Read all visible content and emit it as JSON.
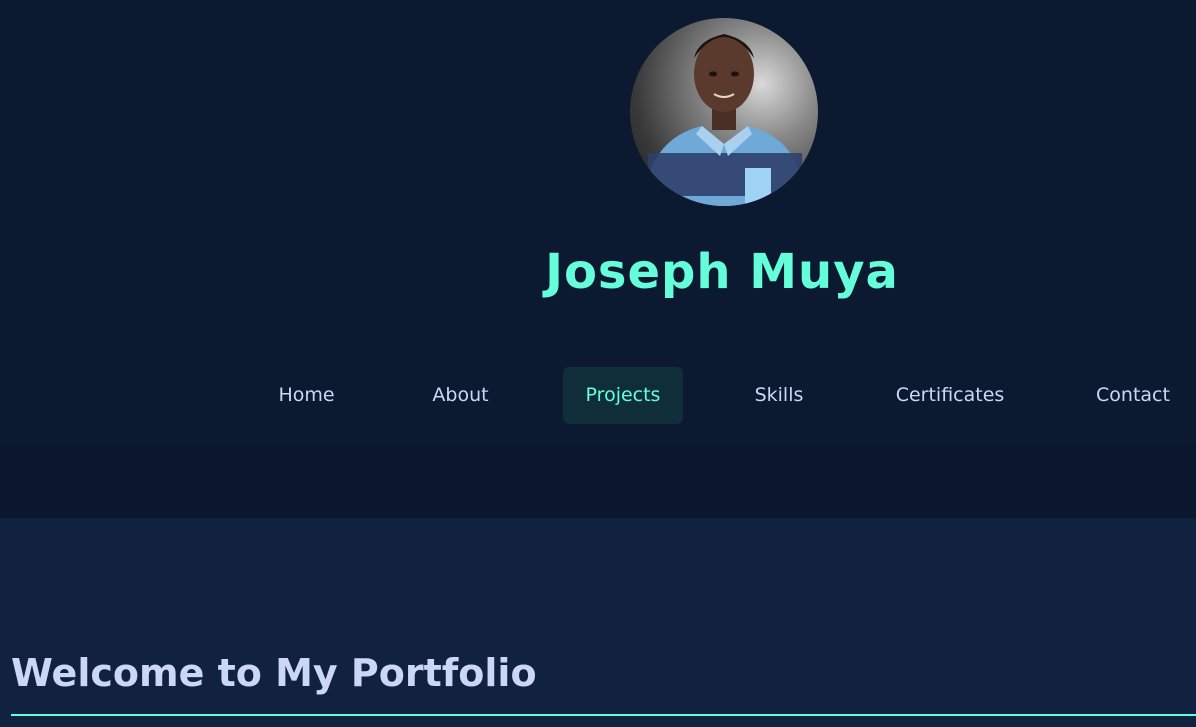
{
  "profile": {
    "name": "Joseph Muya",
    "avatar_alt": "Profile photo"
  },
  "nav": {
    "items": [
      {
        "label": "Home"
      },
      {
        "label": "About"
      },
      {
        "label": "Projects",
        "active": true
      },
      {
        "label": "Skills"
      },
      {
        "label": "Certificates"
      },
      {
        "label": "Contact"
      }
    ]
  },
  "main": {
    "heading": "Welcome to My Portfolio"
  },
  "colors": {
    "accent": "#64ffda",
    "text": "#ccd6f6",
    "header_bg": "#0b1a31",
    "main_bg": "#112240",
    "active_bg": "#0f2e3a"
  }
}
